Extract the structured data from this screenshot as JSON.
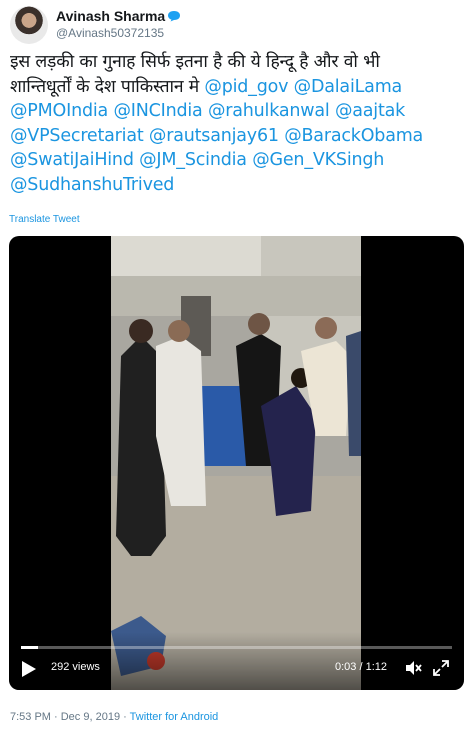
{
  "user": {
    "display_name": "Avinash Sharma",
    "handle": "@Avinash50372135"
  },
  "tweet": {
    "lines": [
      [
        {
          "t": "इस लड़की का गुनाह सिर्फ इतना है की ये हिन्दू है और  वो भी",
          "m": false
        }
      ],
      [
        {
          "t": "शान्तिधूर्तों के देश पाकिस्तान मे ",
          "m": false
        },
        {
          "t": "@pid_gov",
          "m": true
        },
        {
          "t": " ",
          "m": false
        },
        {
          "t": "@DalaiLama",
          "m": true
        }
      ],
      [
        {
          "t": "@PMOIndia",
          "m": true
        },
        {
          "t": " ",
          "m": false
        },
        {
          "t": "@INCIndia",
          "m": true
        },
        {
          "t": " ",
          "m": false
        },
        {
          "t": "@rahulkanwal",
          "m": true
        },
        {
          "t": " ",
          "m": false
        },
        {
          "t": "@aajtak",
          "m": true
        }
      ],
      [
        {
          "t": "@VPSecretariat",
          "m": true
        },
        {
          "t": " ",
          "m": false
        },
        {
          "t": "@rautsanjay61",
          "m": true
        },
        {
          "t": " ",
          "m": false
        },
        {
          "t": "@BarackObama",
          "m": true
        }
      ],
      [
        {
          "t": "@SwatiJaiHind",
          "m": true
        },
        {
          "t": " ",
          "m": false
        },
        {
          "t": "@JM_Scindia",
          "m": true
        },
        {
          "t": " ",
          "m": false
        },
        {
          "t": "@Gen_VKSingh",
          "m": true
        }
      ],
      [
        {
          "t": "@SudhanshuTrived",
          "m": true
        }
      ]
    ]
  },
  "translate_label": "Translate Tweet",
  "video": {
    "views": "292 views",
    "time": "0:03 / 1:12",
    "progress": 0.04
  },
  "footer": {
    "timestamp": "7:53 PM · Dec 9, 2019 · ",
    "source": "Twitter for Android"
  },
  "colors": {
    "link": "#1b95e0",
    "text": "#14171a",
    "secondary": "#657786",
    "verified_bubble": "#1da1f2"
  },
  "icons": [
    "speech-bubble-icon",
    "play-icon",
    "mute-icon",
    "fullscreen-icon"
  ]
}
